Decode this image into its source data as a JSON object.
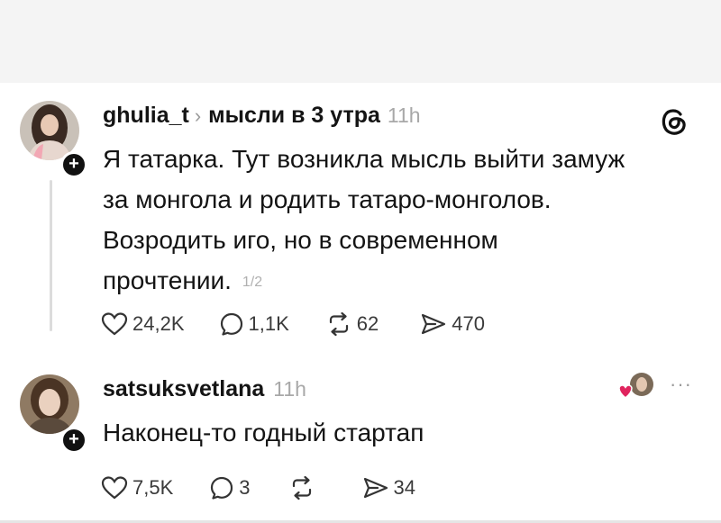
{
  "posts": [
    {
      "username": "ghulia_t",
      "topic": "мысли в 3 утра",
      "time": "11h",
      "text_lines": [
        "Я татарка. Тут возникла мысль выйти замуж",
        "за монгола и родить татаро-монголов.",
        "Возродить иго, но в современном",
        "прочтении."
      ],
      "page_indicator": "1/2",
      "likes": "24,2K",
      "replies": "1,1K",
      "reposts": "62",
      "shares": "470"
    },
    {
      "username": "satsuksvetlana",
      "time": "11h",
      "text_lines": [
        "Наконец-то годный стартап"
      ],
      "likes": "7,5K",
      "replies": "3",
      "shares": "34",
      "more": "···"
    }
  ],
  "icons": {
    "app_logo": "threads-logo-icon",
    "like": "heart-icon",
    "reply": "comment-icon",
    "repost": "repost-icon",
    "share": "send-icon",
    "follow": "plus-icon"
  },
  "colors": {
    "background": "#ffffff",
    "text": "#141414",
    "muted": "#a8a8a8",
    "liked_heart": "#e0245e"
  }
}
